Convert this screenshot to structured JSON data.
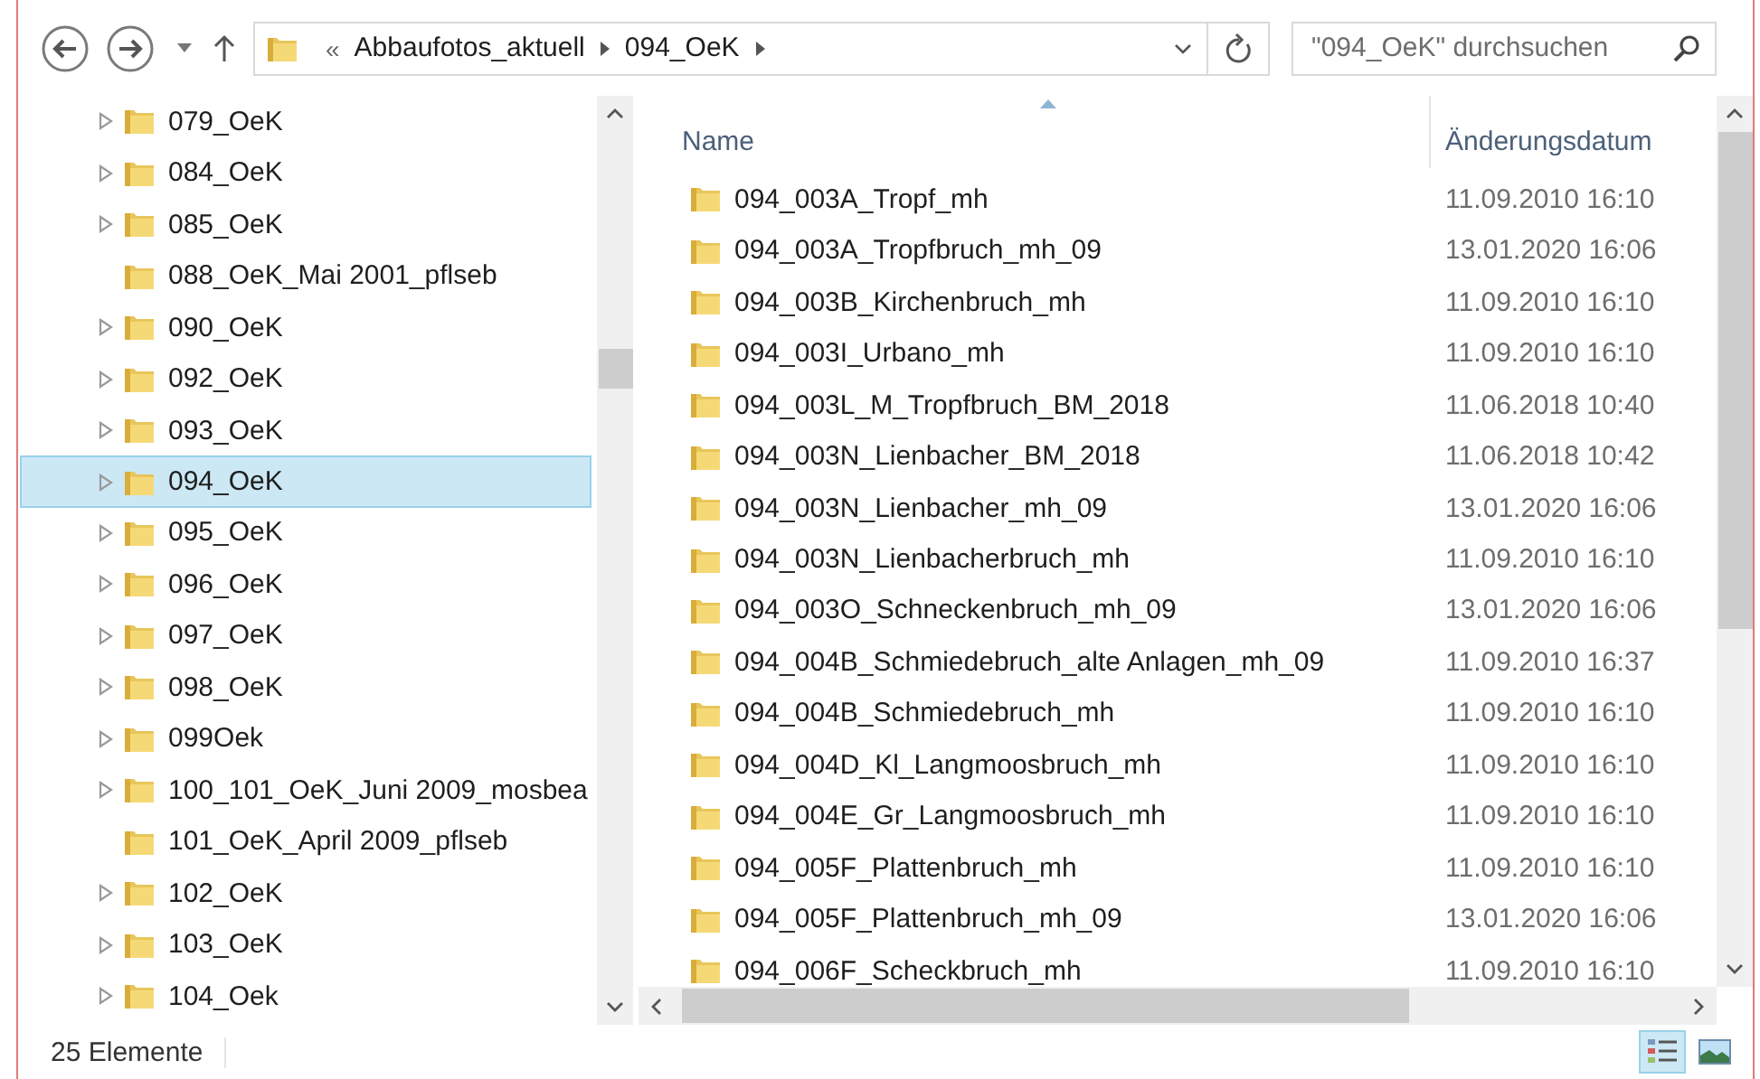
{
  "toolbar": {
    "address": {
      "overflow": "«",
      "segments": [
        "Abbaufotos_aktuell",
        "094_OeK"
      ]
    },
    "search": {
      "placeholder": "\"094_OeK\" durchsuchen"
    }
  },
  "nav_tree": {
    "items": [
      {
        "label": "079_OeK",
        "expandable": true,
        "selected": false
      },
      {
        "label": "084_OeK",
        "expandable": true,
        "selected": false
      },
      {
        "label": "085_OeK",
        "expandable": true,
        "selected": false
      },
      {
        "label": "088_OeK_Mai 2001_pflseb",
        "expandable": false,
        "selected": false
      },
      {
        "label": "090_OeK",
        "expandable": true,
        "selected": false
      },
      {
        "label": "092_OeK",
        "expandable": true,
        "selected": false
      },
      {
        "label": "093_OeK",
        "expandable": true,
        "selected": false
      },
      {
        "label": "094_OeK",
        "expandable": true,
        "selected": true
      },
      {
        "label": "095_OeK",
        "expandable": true,
        "selected": false
      },
      {
        "label": "096_OeK",
        "expandable": true,
        "selected": false
      },
      {
        "label": "097_OeK",
        "expandable": true,
        "selected": false
      },
      {
        "label": "098_OeK",
        "expandable": true,
        "selected": false
      },
      {
        "label": "099Oek",
        "expandable": true,
        "selected": false
      },
      {
        "label": "100_101_OeK_Juni 2009_mosbea",
        "expandable": true,
        "selected": false
      },
      {
        "label": "101_OeK_April 2009_pflseb",
        "expandable": false,
        "selected": false
      },
      {
        "label": "102_OeK",
        "expandable": true,
        "selected": false
      },
      {
        "label": "103_OeK",
        "expandable": true,
        "selected": false
      },
      {
        "label": "104_Oek",
        "expandable": true,
        "selected": false
      }
    ]
  },
  "file_list": {
    "columns": [
      {
        "label": "Name",
        "sorted": true
      },
      {
        "label": "Änderungsdatum",
        "sorted": false
      }
    ],
    "rows": [
      {
        "name": "094_003A_Tropf_mh",
        "date": "11.09.2010 16:10"
      },
      {
        "name": "094_003A_Tropfbruch_mh_09",
        "date": "13.01.2020 16:06"
      },
      {
        "name": "094_003B_Kirchenbruch_mh",
        "date": "11.09.2010 16:10"
      },
      {
        "name": "094_003I_Urbano_mh",
        "date": "11.09.2010 16:10"
      },
      {
        "name": "094_003L_M_Tropfbruch_BM_2018",
        "date": "11.06.2018 10:40"
      },
      {
        "name": "094_003N_Lienbacher_BM_2018",
        "date": "11.06.2018 10:42"
      },
      {
        "name": "094_003N_Lienbacher_mh_09",
        "date": "13.01.2020 16:06"
      },
      {
        "name": "094_003N_Lienbacherbruch_mh",
        "date": "11.09.2010 16:10"
      },
      {
        "name": "094_003O_Schneckenbruch_mh_09",
        "date": "13.01.2020 16:06"
      },
      {
        "name": "094_004B_Schmiedebruch_alte Anlagen_mh_09",
        "date": "11.09.2010 16:37"
      },
      {
        "name": "094_004B_Schmiedebruch_mh",
        "date": "11.09.2010 16:10"
      },
      {
        "name": "094_004D_Kl_Langmoosbruch_mh",
        "date": "11.09.2010 16:10"
      },
      {
        "name": "094_004E_Gr_Langmoosbruch_mh",
        "date": "11.09.2010 16:10"
      },
      {
        "name": "094_005F_Plattenbruch_mh",
        "date": "11.09.2010 16:10"
      },
      {
        "name": "094_005F_Plattenbruch_mh_09",
        "date": "13.01.2020 16:06"
      },
      {
        "name": "094_006F_Scheckbruch_mh",
        "date": "11.09.2010 16:10"
      }
    ]
  },
  "status_bar": {
    "item_count": "25 Elemente",
    "view_buttons": [
      {
        "kind": "details",
        "selected": true
      },
      {
        "kind": "large-icons",
        "selected": false
      }
    ]
  }
}
